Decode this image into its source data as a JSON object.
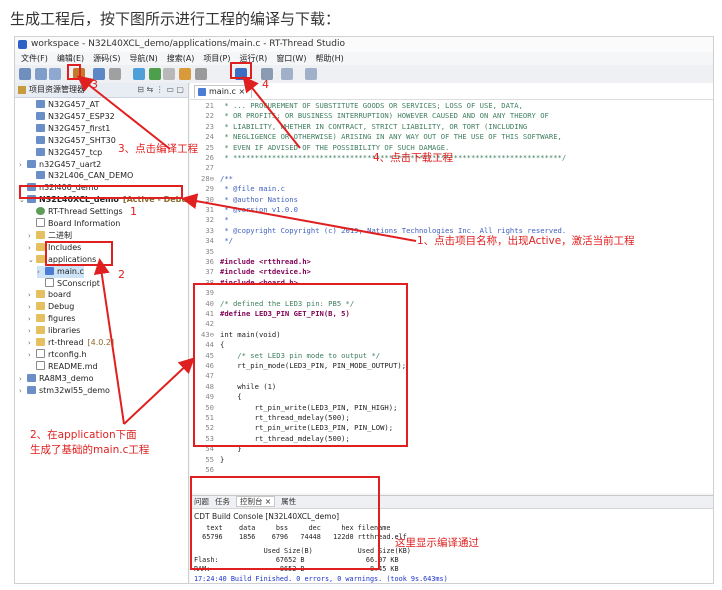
{
  "intro": "生成工程后，按下图所示进行工程的编译与下载：",
  "window_title": "workspace - N32L40XCL_demo/applications/main.c - RT-Thread Studio",
  "menu": [
    "文件(F)",
    "编辑(E)",
    "源码(S)",
    "导航(N)",
    "搜索(A)",
    "项目(P)",
    "运行(R)",
    "窗口(W)",
    "帮助(H)"
  ],
  "project_explorer": {
    "title": "项目资源管理器",
    "items": [
      {
        "label": "N32G457_AT",
        "depth": 1,
        "twisty": "",
        "icon": "project"
      },
      {
        "label": "N32G457_ESP32",
        "depth": 1,
        "twisty": "",
        "icon": "project"
      },
      {
        "label": "N32G457_first1",
        "depth": 1,
        "twisty": "",
        "icon": "project"
      },
      {
        "label": "N32G457_SHT30",
        "depth": 1,
        "twisty": "",
        "icon": "project"
      },
      {
        "label": "N32G457_tcp",
        "depth": 1,
        "twisty": "",
        "icon": "project"
      },
      {
        "label": "n32G457_uart2",
        "depth": 0,
        "twisty": "›",
        "icon": "project"
      },
      {
        "label": "N32L406_CAN_DEMO",
        "depth": 1,
        "twisty": "",
        "icon": "project"
      },
      {
        "label": "n32l406_demo",
        "depth": 0,
        "twisty": "›",
        "icon": "project"
      },
      {
        "label": "N32L40XCL_demo",
        "depth": 0,
        "twisty": "⌄",
        "icon": "project",
        "suffix": "[Active - Debug]",
        "bold": true
      },
      {
        "label": "RT-Thread Settings",
        "depth": 1,
        "twisty": "",
        "icon": "gear"
      },
      {
        "label": "Board Information",
        "depth": 1,
        "twisty": "",
        "icon": "file"
      },
      {
        "label": "二进制",
        "depth": 1,
        "twisty": "›",
        "icon": "folder"
      },
      {
        "label": "Includes",
        "depth": 1,
        "twisty": "›",
        "icon": "folder"
      },
      {
        "label": "applications",
        "depth": 1,
        "twisty": "⌄",
        "icon": "folder"
      },
      {
        "label": "main.c",
        "depth": 2,
        "twisty": "›",
        "icon": "cfile",
        "selected": true
      },
      {
        "label": "SConscript",
        "depth": 2,
        "twisty": "",
        "icon": "file"
      },
      {
        "label": "board",
        "depth": 1,
        "twisty": "›",
        "icon": "folder"
      },
      {
        "label": "Debug",
        "depth": 1,
        "twisty": "›",
        "icon": "folder"
      },
      {
        "label": "figures",
        "depth": 1,
        "twisty": "›",
        "icon": "folder"
      },
      {
        "label": "libraries",
        "depth": 1,
        "twisty": "›",
        "icon": "folder"
      },
      {
        "label": "rt-thread",
        "depth": 1,
        "twisty": "›",
        "icon": "folder",
        "suffix": "[4.0.2]"
      },
      {
        "label": "rtconfig.h",
        "depth": 1,
        "twisty": "›",
        "icon": "file"
      },
      {
        "label": "README.md",
        "depth": 1,
        "twisty": "",
        "icon": "file"
      },
      {
        "label": "RA8M3_demo",
        "depth": 0,
        "twisty": "›",
        "icon": "project"
      },
      {
        "label": "stm32wl55_demo",
        "depth": 0,
        "twisty": "›",
        "icon": "project"
      }
    ]
  },
  "editor": {
    "tab": "main.c",
    "lines": [
      {
        "n": "21",
        "text": " * ... PROCUREMENT OF SUBSTITUTE GOODS OR SERVICES; LOSS OF USE, DATA,",
        "cls": "cm"
      },
      {
        "n": "22",
        "text": " * OR PROFITS; OR BUSINESS INTERRUPTION) HOWEVER CAUSED AND ON ANY THEORY OF",
        "cls": "cm"
      },
      {
        "n": "23",
        "text": " * LIABILITY, WHETHER IN CONTRACT, STRICT LIABILITY, OR TORT (INCLUDING",
        "cls": "cm"
      },
      {
        "n": "24",
        "text": " * NEGLIGENCE OR OTHERWISE) ARISING IN ANY WAY OUT OF THE USE OF THIS SOFTWARE,",
        "cls": "cm"
      },
      {
        "n": "25",
        "text": " * EVEN IF ADVISED OF THE POSSIBILITY OF SUCH DAMAGE.",
        "cls": "cm"
      },
      {
        "n": "26",
        "text": " * ****************************************************************************/",
        "cls": "cm"
      },
      {
        "n": "27",
        "text": "",
        "cls": ""
      },
      {
        "n": "28⊖",
        "text": "/**",
        "cls": "cm2"
      },
      {
        "n": "29",
        "text": " * @file main.c",
        "cls": "cm2"
      },
      {
        "n": "30",
        "text": " * @author Nations",
        "cls": "cm2"
      },
      {
        "n": "31",
        "text": " * @version v1.0.0",
        "cls": "cm2"
      },
      {
        "n": "32",
        "text": " *",
        "cls": "cm2"
      },
      {
        "n": "33",
        "text": " * @copyright Copyright (c) 2019, Nations Technologies Inc. All rights reserved.",
        "cls": "cm2"
      },
      {
        "n": "34",
        "text": " */",
        "cls": "cm2"
      },
      {
        "n": "35",
        "text": "",
        "cls": ""
      },
      {
        "n": "36",
        "text": "#include <rtthread.h>",
        "cls": "inc"
      },
      {
        "n": "37",
        "text": "#include <rtdevice.h>",
        "cls": "inc"
      },
      {
        "n": "38",
        "text": "#include <board.h>",
        "cls": "inc"
      },
      {
        "n": "39",
        "text": "",
        "cls": ""
      },
      {
        "n": "40",
        "text": "/* defined the LED3 pin: PB5 */",
        "cls": "cm"
      },
      {
        "n": "41",
        "text": "#define LED3_PIN GET_PIN(B, 5)",
        "cls": "inc"
      },
      {
        "n": "42",
        "text": "",
        "cls": ""
      },
      {
        "n": "43⊖",
        "text": "int main(void)",
        "cls": "fn"
      },
      {
        "n": "44",
        "text": "{",
        "cls": ""
      },
      {
        "n": "45",
        "text": "    /* set LED3 pin mode to output */",
        "cls": "cm"
      },
      {
        "n": "46",
        "text": "    rt_pin_mode(LED3_PIN, PIN_MODE_OUTPUT);",
        "cls": ""
      },
      {
        "n": "47",
        "text": "",
        "cls": ""
      },
      {
        "n": "48",
        "text": "    while (1)",
        "cls": "kwline"
      },
      {
        "n": "49",
        "text": "    {",
        "cls": ""
      },
      {
        "n": "50",
        "text": "        rt_pin_write(LED3_PIN, PIN_HIGH);",
        "cls": ""
      },
      {
        "n": "51",
        "text": "        rt_thread_mdelay(500);",
        "cls": ""
      },
      {
        "n": "52",
        "text": "        rt_pin_write(LED3_PIN, PIN_LOW);",
        "cls": ""
      },
      {
        "n": "53",
        "text": "        rt_thread_mdelay(500);",
        "cls": ""
      },
      {
        "n": "54",
        "text": "    }",
        "cls": ""
      },
      {
        "n": "55",
        "text": "}",
        "cls": ""
      },
      {
        "n": "56",
        "text": "",
        "cls": ""
      }
    ]
  },
  "console": {
    "tabs": [
      "问题",
      "任务",
      "控制台 ×",
      "属性"
    ],
    "title": "CDT Build Console [N32L40XCL_demo]",
    "size_header": "   text    data     bss     dec     hex filename",
    "size_values": "  65796    1856    6796   74448   122d0 rtthread.elf",
    "used_header": "                 Used Size(B)           Used Size(KB)",
    "flash": "Flash:              67652 B               66.07 KB",
    "ram": "RAM:                 8652 B                8.45 KB",
    "finished": "17:24:40 Build Finished. 0 errors, 0 warnings. (took 9s.643ms)"
  },
  "annotations": {
    "a1": "1、点击项目名称，出现Active，激活当前工程",
    "a1_num": "1",
    "a2": "2、在application下面\n生成了基础的main.c工程",
    "a2_num": "2",
    "a3": "3、点击编译工程",
    "a3_num": "3",
    "a4": "4、点击下载工程",
    "a4_num": "4",
    "a5": "这里显示编译通过"
  }
}
